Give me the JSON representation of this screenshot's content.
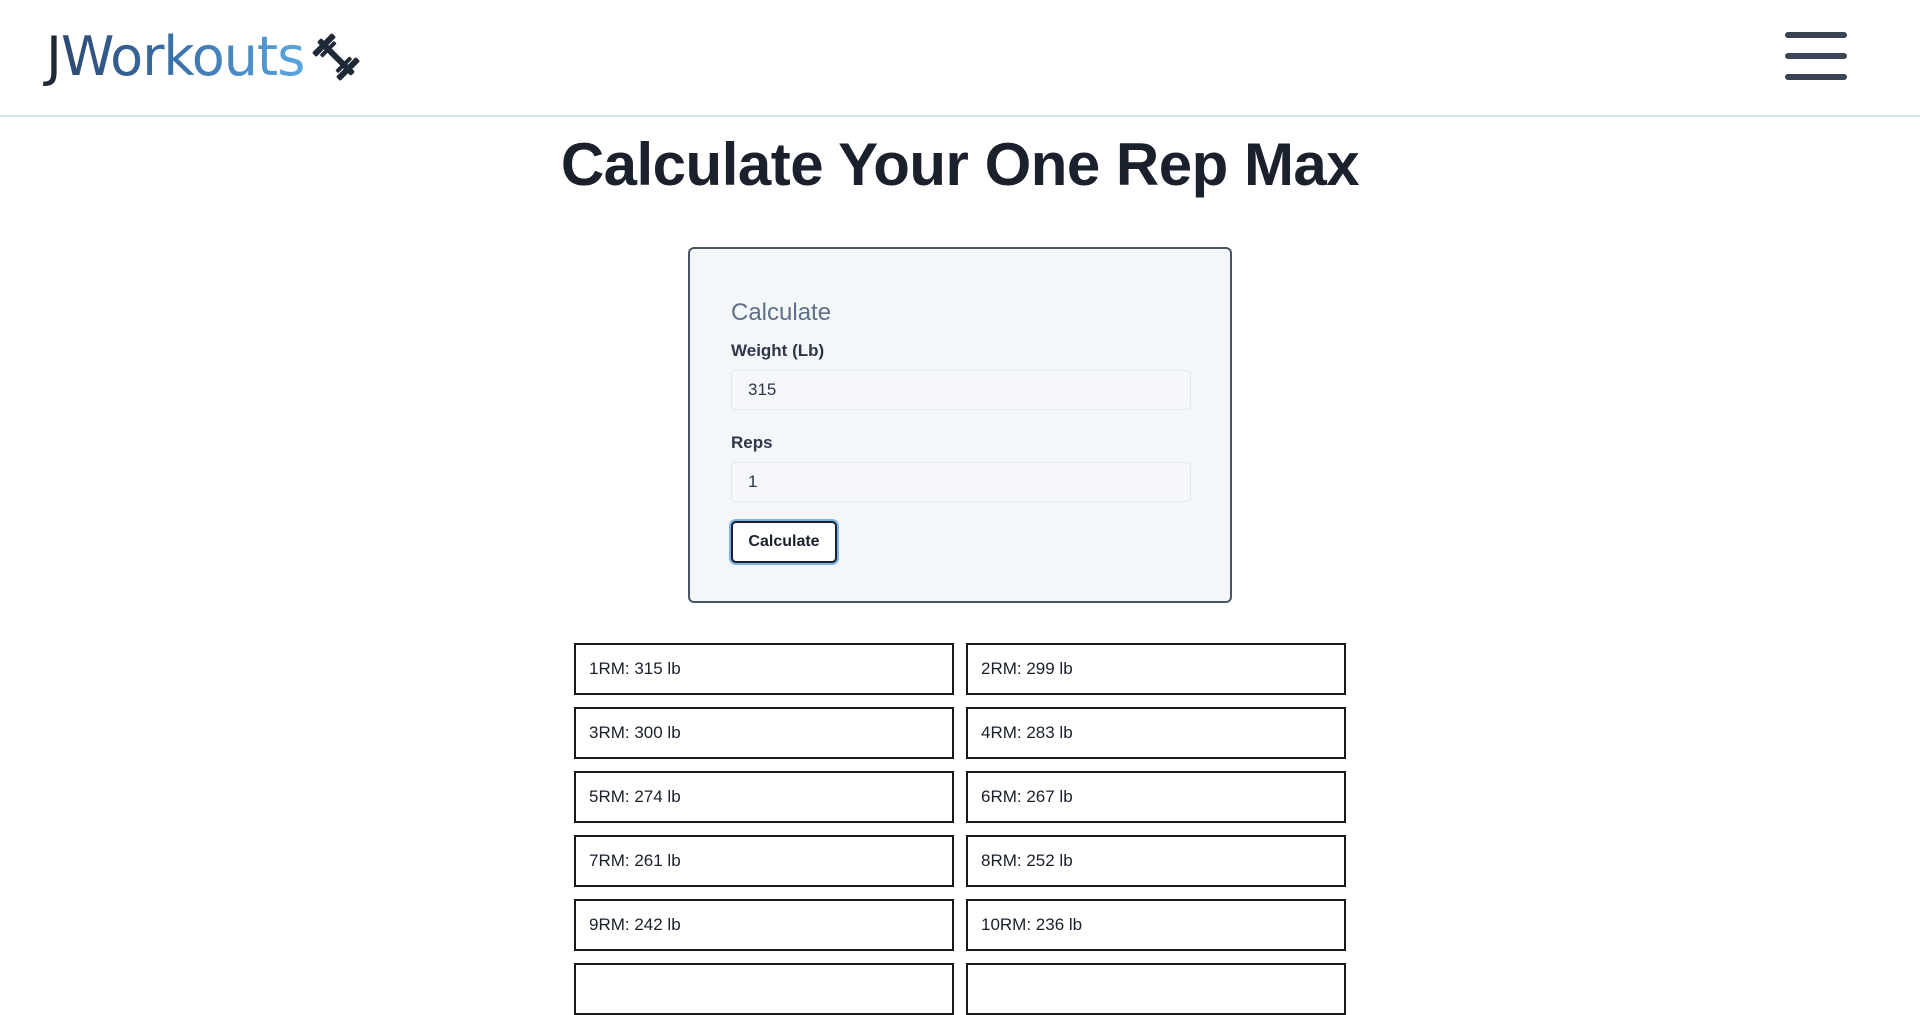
{
  "header": {
    "logo_j": "J",
    "logo_workouts": "Workouts",
    "logo_icon": "barbell-icon",
    "menu_icon": "hamburger-menu-icon"
  },
  "page_title": "Calculate Your One Rep Max",
  "calculator": {
    "heading": "Calculate",
    "weight_label": "Weight (Lb)",
    "weight_value": "315",
    "reps_label": "Reps",
    "reps_value": "1",
    "button_label": "Calculate"
  },
  "results": [
    "1RM: 315 lb",
    "2RM: 299 lb",
    "3RM: 300 lb",
    "4RM: 283 lb",
    "5RM: 274 lb",
    "6RM: 267 lb",
    "7RM: 261 lb",
    "8RM: 252 lb",
    "9RM: 242 lb",
    "10RM: 236 lb",
    "",
    ""
  ],
  "colors": {
    "logo_dark": "#1f2937",
    "logo_gradient_start": "#2c4a72",
    "logo_gradient_end": "#5aa6e0",
    "card_border": "#4a5568",
    "button_focus_ring": "#7fb3e6"
  }
}
